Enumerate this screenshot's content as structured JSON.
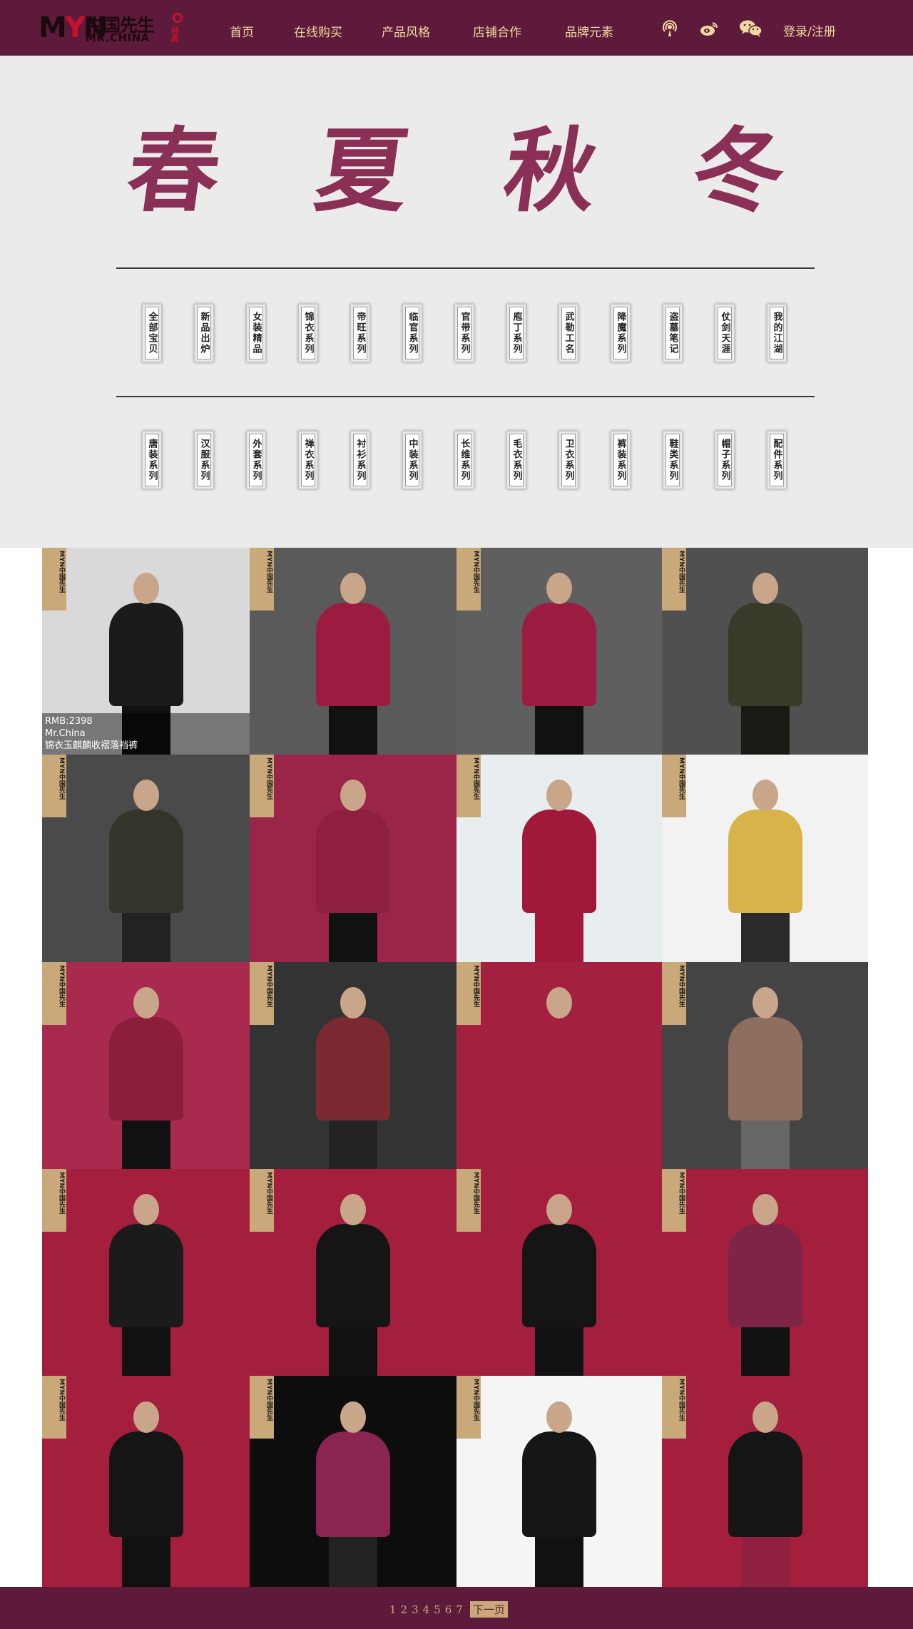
{
  "header": {
    "logo": {
      "mark": "MYN",
      "cn": "中国先生",
      "en": "MR.CHINA",
      "tag": "经典"
    },
    "nav": [
      "首页",
      "在线购买",
      "产品风格",
      "店铺合作",
      "品牌元素"
    ],
    "icons": [
      "podcast-icon",
      "weibo-icon",
      "wechat-icon"
    ],
    "login": "登录/注册"
  },
  "banner": {
    "title_chars": [
      "春",
      "夏",
      "秋",
      "冬"
    ],
    "row1": [
      "全部宝贝",
      "新品出炉",
      "女装精品",
      "锦衣系列",
      "帝旺系列",
      "临官系列",
      "官带系列",
      "庖丁系列",
      "武勒工名",
      "降魔系列",
      "盗墓笔记",
      "仗剑天涯",
      "我的江湖"
    ],
    "row2": [
      "唐装系列",
      "汉服系列",
      "外套系列",
      "禅衣系列",
      "衬衫系列",
      "中装系列",
      "长维系列",
      "毛衣系列",
      "卫衣系列",
      "裤装系列",
      "鞋类系列",
      "帽子系列",
      "配件系列"
    ]
  },
  "products": {
    "badge": "MYN中国先生",
    "first": {
      "price": "RMB:2398",
      "brand": "Mr.China",
      "name": "锦衣玉麒麟收褶落裆裤"
    }
  },
  "pager": {
    "pages": [
      "1",
      "2",
      "3",
      "4",
      "5",
      "6",
      "7"
    ],
    "next": "下一页"
  },
  "colors": {
    "brand": "#5e1a3a",
    "gold": "#f2d9a2",
    "accent": "#8a2f55"
  }
}
